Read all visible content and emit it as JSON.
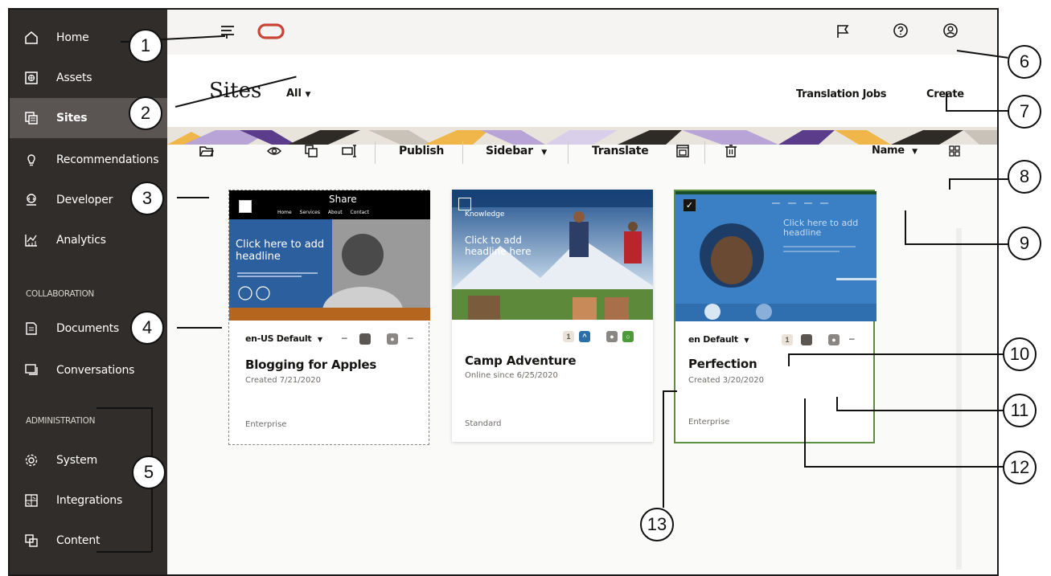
{
  "sidebar": {
    "items": [
      {
        "label": "Home",
        "icon": "home-icon"
      },
      {
        "label": "Assets",
        "icon": "assets-icon"
      },
      {
        "label": "Sites",
        "icon": "sites-icon",
        "active": true
      },
      {
        "label": "Recommendations",
        "icon": "lightbulb-icon"
      },
      {
        "label": "Developer",
        "icon": "developer-icon"
      },
      {
        "label": "Analytics",
        "icon": "chart-icon"
      }
    ],
    "collaboration_heading": "COLLABORATION",
    "collaboration": [
      {
        "label": "Documents",
        "icon": "documents-icon"
      },
      {
        "label": "Conversations",
        "icon": "conversations-icon"
      }
    ],
    "administration_heading": "ADMINISTRATION",
    "administration": [
      {
        "label": "System",
        "icon": "gear-icon"
      },
      {
        "label": "Integrations",
        "icon": "integrations-icon"
      },
      {
        "label": "Content",
        "icon": "content-icon"
      }
    ]
  },
  "header": {
    "title": "Sites",
    "filter": "All",
    "translation_jobs": "Translation Jobs",
    "create": "Create"
  },
  "toolbar": {
    "publish": "Publish",
    "sidebar": "Sidebar",
    "translate": "Translate",
    "sort": "Name"
  },
  "cards": [
    {
      "name": "Blogging for Apples",
      "date": "Created 7/21/2020",
      "type": "Enterprise",
      "language": "en-US Default",
      "thumb_brand": "Share",
      "thumb_nav": [
        "Home",
        "Services",
        "About",
        "Contact"
      ],
      "thumb_headline": "Click here to add headline"
    },
    {
      "name": "Camp Adventure",
      "date": "Online since 6/25/2020",
      "type": "Standard",
      "badge_count": "1",
      "thumb_kicker": "Knowledge",
      "thumb_headline": "Click to add headline here"
    },
    {
      "name": "Perfection",
      "date": "Created 3/20/2020",
      "type": "Enterprise",
      "language": "en Default",
      "badge_count": "1",
      "thumb_headline": "Click here to add headline"
    }
  ],
  "callouts": [
    "1",
    "2",
    "3",
    "4",
    "5",
    "6",
    "7",
    "8",
    "9",
    "10",
    "11",
    "12",
    "13"
  ],
  "colors": {
    "sidebar_bg": "#312d2a",
    "active_bg": "#5a5552",
    "oracle_red": "#c74634",
    "selected_border": "#5a8f3f"
  }
}
